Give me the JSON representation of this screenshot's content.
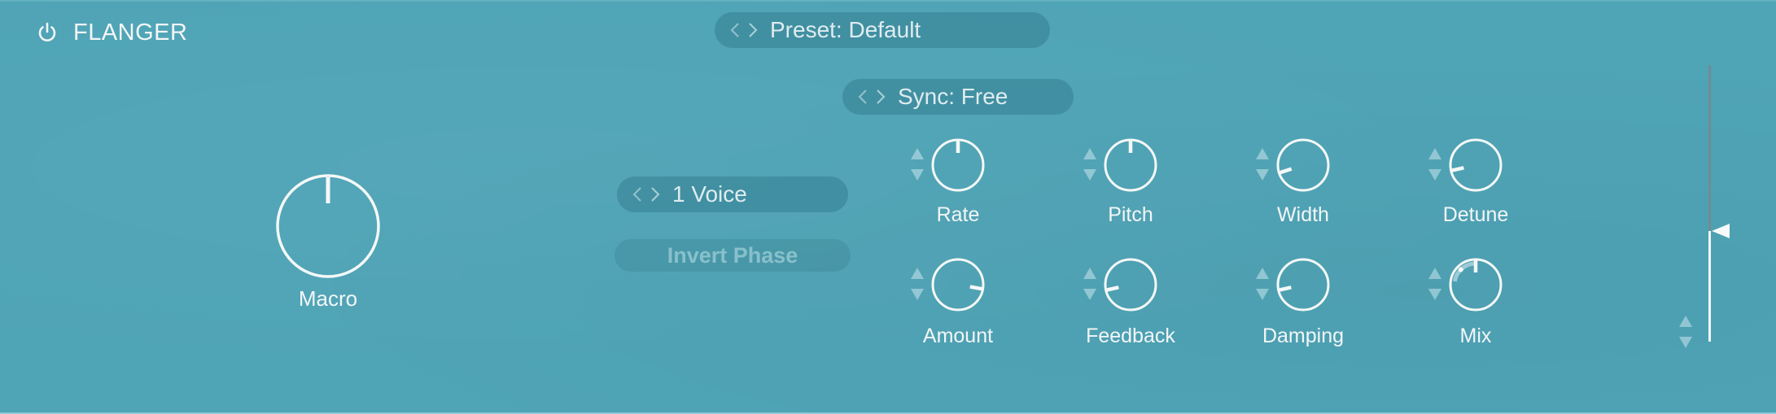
{
  "plugin": {
    "title": "FLANGER",
    "power_icon": "power-icon",
    "enabled": true
  },
  "preset": {
    "label": "Preset: Default",
    "prev_icon": "chevron-left-icon",
    "next_icon": "chevron-right-icon"
  },
  "sync": {
    "label": "Sync: Free",
    "prev_icon": "chevron-left-icon",
    "next_icon": "chevron-right-icon"
  },
  "voices": {
    "label": "1 Voice",
    "prev_icon": "chevron-left-icon",
    "next_icon": "chevron-right-icon"
  },
  "invert_phase": {
    "label": "Invert Phase",
    "active": false
  },
  "macro": {
    "label": "Macro",
    "value": 0.5
  },
  "knobs": [
    {
      "id": "rate",
      "label": "Rate",
      "value": 0.5
    },
    {
      "id": "pitch",
      "label": "Pitch",
      "value": 0.5
    },
    {
      "id": "width",
      "label": "Width",
      "value": 0.1
    },
    {
      "id": "detune",
      "label": "Detune",
      "value": 0.12
    },
    {
      "id": "amount",
      "label": "Amount",
      "value": 0.87
    },
    {
      "id": "feedback",
      "label": "Feedback",
      "value": 0.12
    },
    {
      "id": "damping",
      "label": "Damping",
      "value": 0.12
    },
    {
      "id": "mix",
      "label": "Mix",
      "value": 0.5,
      "modulation_range": 0.3
    }
  ],
  "output_slider": {
    "value": 0.4
  },
  "colors": {
    "background": "#4fa4b6",
    "knob_stroke": "#f4f8f8",
    "slider_track": "#708c92",
    "pill_bg": "#2e7d90"
  }
}
